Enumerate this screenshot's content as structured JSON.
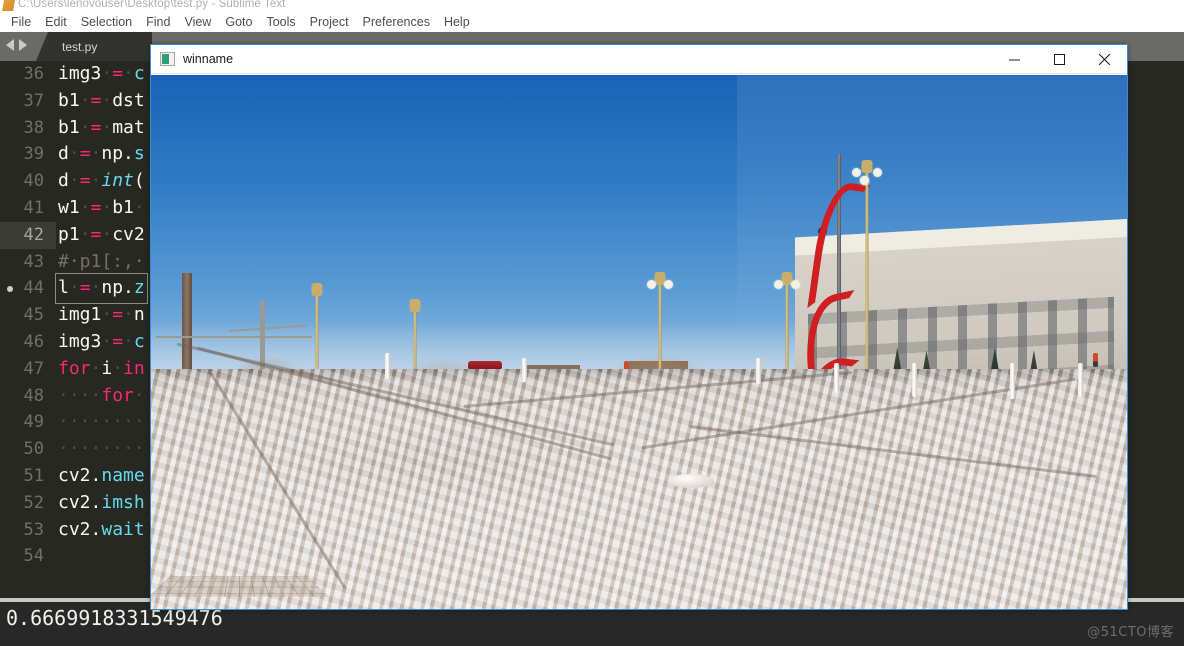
{
  "sublime": {
    "title": "C:\\Users\\lenovouser\\Desktop\\test.py - Sublime Text",
    "app_icon": "sublime-text-icon",
    "menu": [
      {
        "label": "File"
      },
      {
        "label": "Edit"
      },
      {
        "label": "Selection"
      },
      {
        "label": "Find"
      },
      {
        "label": "View"
      },
      {
        "label": "Goto"
      },
      {
        "label": "Tools"
      },
      {
        "label": "Project"
      },
      {
        "label": "Preferences"
      },
      {
        "label": "Help"
      }
    ],
    "tab": {
      "label": "test.py"
    },
    "nav": {
      "prev_icon": "arrow-left-icon",
      "next_icon": "arrow-right-icon"
    },
    "code_lines": [
      {
        "number": "36",
        "text": "img3 = c"
      },
      {
        "number": "37",
        "text": "b1 = dst"
      },
      {
        "number": "38",
        "text": "b1 = mat"
      },
      {
        "number": "39",
        "text": "d = np.s"
      },
      {
        "number": "40",
        "text": "d = int("
      },
      {
        "number": "41",
        "text": "w1 = b1 "
      },
      {
        "number": "42",
        "text": "p1 = cv2"
      },
      {
        "number": "43",
        "text": "# p1[:, "
      },
      {
        "number": "44",
        "text": "l = np.z"
      },
      {
        "number": "45",
        "text": "img1 = n"
      },
      {
        "number": "46",
        "text": "img3 = c"
      },
      {
        "number": "47",
        "text": "for i in"
      },
      {
        "number": "48",
        "text": "    for "
      },
      {
        "number": "49",
        "text": "        "
      },
      {
        "number": "50",
        "text": "        "
      },
      {
        "number": "51",
        "text": "cv2.name"
      },
      {
        "number": "52",
        "text": "cv2.imsh"
      },
      {
        "number": "53",
        "text": "cv2.wait"
      },
      {
        "number": "54",
        "text": ""
      }
    ],
    "console_output": "0.6669918331549476",
    "colors": {
      "editor_bg": "#272822",
      "gutter_text": "#707066",
      "operator": "#f92672",
      "keyword": "#f92672",
      "function": "#66d9ef",
      "comment": "#75715e",
      "foreground": "#f8f8f2",
      "tab_strip": "#6a6a66"
    }
  },
  "viewer": {
    "title": "winname",
    "icon": "image-window-icon",
    "controls": {
      "minimize": "minimize-icon",
      "maximize": "maximize-icon",
      "close": "close-icon"
    },
    "accent_border": "#3a8dd4",
    "image_description": "Panoramic stitched winter cityscape: blue sky, red ribbon sculpture, ornate street lamps, bare trees, buildings and a snow-patched plaza"
  },
  "watermark": {
    "text": "@51CTO博客"
  }
}
